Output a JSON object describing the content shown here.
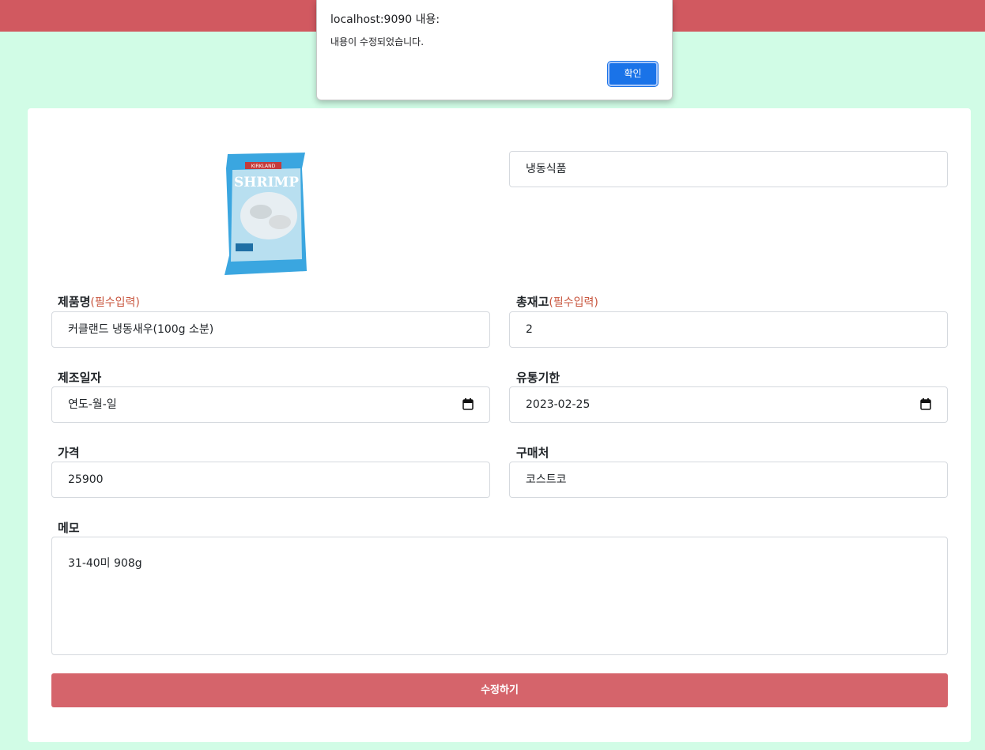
{
  "dialog": {
    "title": "localhost:9090 내용:",
    "message": "내용이 수정되었습니다.",
    "ok_label": "확인"
  },
  "product": {
    "category": "냉동식품",
    "image_alt": "SHRIMP",
    "image_brand": "KIRKLAND"
  },
  "form": {
    "name_label": "제품명",
    "name_required": "(필수입력)",
    "name_value": "커클랜드 냉동새우(100g 소분)",
    "stock_label": "총재고",
    "stock_required": "(필수입력)",
    "stock_value": "2",
    "mfg_label": "제조일자",
    "mfg_placeholder": "연도-월-일",
    "exp_label": "유통기한",
    "exp_value": "2023-02-25",
    "price_label": "가격",
    "price_value": "25900",
    "store_label": "구매처",
    "store_value": "코스트코",
    "memo_label": "메모",
    "memo_value": "31-40미 908g",
    "submit_label": "수정하기"
  },
  "colors": {
    "header": "#d15960",
    "background": "#d1fce6",
    "submit": "#d5646b",
    "required": "#c8553d",
    "dialog_button": "#1a73e8"
  }
}
